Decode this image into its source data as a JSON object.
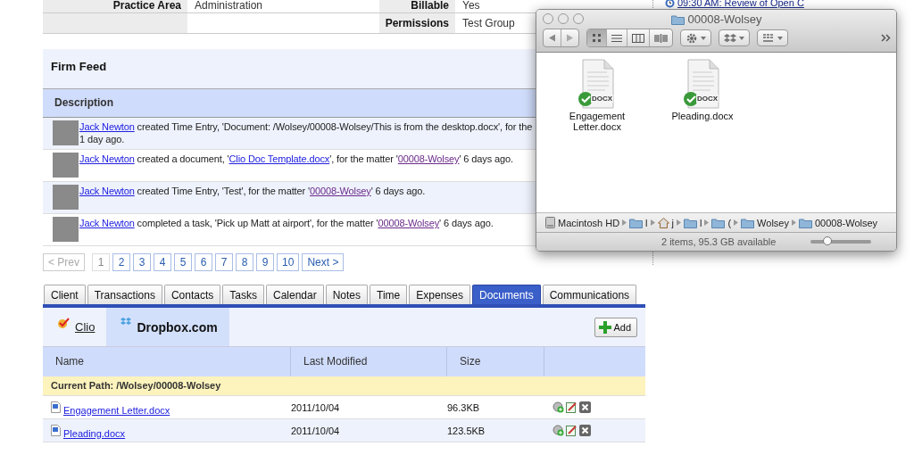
{
  "matter_info": {
    "rows": [
      {
        "left": {
          "label": "Practice Area",
          "value": "Administration"
        },
        "right": {
          "label": "Billable",
          "value": "Yes"
        }
      },
      {
        "right": {
          "label": "Permissions",
          "value": "Test Group"
        }
      }
    ]
  },
  "agenda": {
    "items": [
      {
        "text": "09:30 AM: Review of Open C"
      }
    ]
  },
  "firm_feed": {
    "title": "Firm Feed",
    "column": "Description",
    "entries": [
      {
        "segments": [
          {
            "kind": "link",
            "text": "Jack Newton"
          },
          {
            "kind": "text",
            "text": " created Time Entry, 'Document: /Wolsey/00008-Wolsey/This is from the desktop.docx', for the"
          },
          {
            "kind": "line",
            "text": "1 day ago."
          }
        ]
      },
      {
        "segments": [
          {
            "kind": "link",
            "text": "Jack Newton"
          },
          {
            "kind": "text",
            "text": " created a document, '"
          },
          {
            "kind": "link",
            "text": "Clio Doc Template.docx"
          },
          {
            "kind": "text",
            "text": "', for the matter '"
          },
          {
            "kind": "visited-link",
            "text": "00008-Wolsey"
          },
          {
            "kind": "text",
            "text": "' 6 days ago."
          }
        ]
      },
      {
        "segments": [
          {
            "kind": "link",
            "text": "Jack Newton"
          },
          {
            "kind": "text",
            "text": " created Time Entry, 'Test', for the matter '"
          },
          {
            "kind": "visited-link",
            "text": "00008-Wolsey"
          },
          {
            "kind": "text",
            "text": "' 6 days ago."
          }
        ]
      },
      {
        "segments": [
          {
            "kind": "link",
            "text": "Jack Newton"
          },
          {
            "kind": "text",
            "text": " completed a task, 'Pick up Matt at airport', for the matter '"
          },
          {
            "kind": "visited-link",
            "text": "00008-Wolsey"
          },
          {
            "kind": "text",
            "text": "' 6 days ago."
          }
        ]
      }
    ],
    "pagination": [
      {
        "label": "< Prev",
        "selected": false,
        "disabled": true
      },
      {
        "label": "1",
        "selected": true,
        "disabled": false
      },
      {
        "label": "2",
        "selected": false,
        "disabled": false
      },
      {
        "label": "3",
        "selected": false,
        "disabled": false
      },
      {
        "label": "4",
        "selected": false,
        "disabled": false
      },
      {
        "label": "5",
        "selected": false,
        "disabled": false
      },
      {
        "label": "6",
        "selected": false,
        "disabled": false
      },
      {
        "label": "7",
        "selected": false,
        "disabled": false
      },
      {
        "label": "8",
        "selected": false,
        "disabled": false
      },
      {
        "label": "9",
        "selected": false,
        "disabled": false
      },
      {
        "label": "10",
        "selected": false,
        "disabled": false
      },
      {
        "label": "Next >",
        "selected": false,
        "disabled": false
      }
    ]
  },
  "tabs": [
    {
      "label": "Client",
      "selected": false
    },
    {
      "label": "Transactions",
      "selected": false
    },
    {
      "label": "Contacts",
      "selected": false
    },
    {
      "label": "Tasks",
      "selected": false
    },
    {
      "label": "Calendar",
      "selected": false
    },
    {
      "label": "Notes",
      "selected": false
    },
    {
      "label": "Time",
      "selected": false
    },
    {
      "label": "Expenses",
      "selected": false
    },
    {
      "label": "Documents",
      "selected": true
    },
    {
      "label": "Communications",
      "selected": false
    }
  ],
  "documents": {
    "sources": [
      {
        "kind": "clio",
        "label": "Clio",
        "selected": false
      },
      {
        "kind": "dropbox",
        "label": "Dropbox.com",
        "selected": true
      }
    ],
    "add_button": "Add",
    "columns": [
      "Name",
      "Last Modified",
      "Size"
    ],
    "current_path": "Current Path: /Wolsey/00008-Wolsey",
    "rows": [
      {
        "name": "Engagement Letter.docx",
        "modified": "2011/10/04",
        "size": "96.3KB"
      },
      {
        "name": "Pleading.docx",
        "modified": "2011/10/04",
        "size": "123.5KB"
      }
    ]
  },
  "finder": {
    "title": "00008-Wolsey",
    "view_modes": [
      {
        "kind": "icon",
        "selected": true
      },
      {
        "kind": "list",
        "selected": false
      },
      {
        "kind": "columns",
        "selected": false
      },
      {
        "kind": "coverflow",
        "selected": false
      }
    ],
    "files": [
      {
        "name": "Engagement Letter.docx",
        "badge": "DOCX"
      },
      {
        "name": "Pleading.docx",
        "badge": "DOCX"
      }
    ],
    "path": [
      {
        "kind": "disk",
        "label": "Macintosh HD"
      },
      {
        "kind": "folder",
        "label": "l"
      },
      {
        "kind": "home",
        "label": "j"
      },
      {
        "kind": "folder",
        "label": "l"
      },
      {
        "kind": "folder",
        "label": "("
      },
      {
        "kind": "folder",
        "label": "Wolsey"
      },
      {
        "kind": "folder",
        "label": "00008-Wolsey"
      }
    ],
    "status": "2 items, 95.3 GB available",
    "icon_size": {
      "level": 0.3
    }
  }
}
